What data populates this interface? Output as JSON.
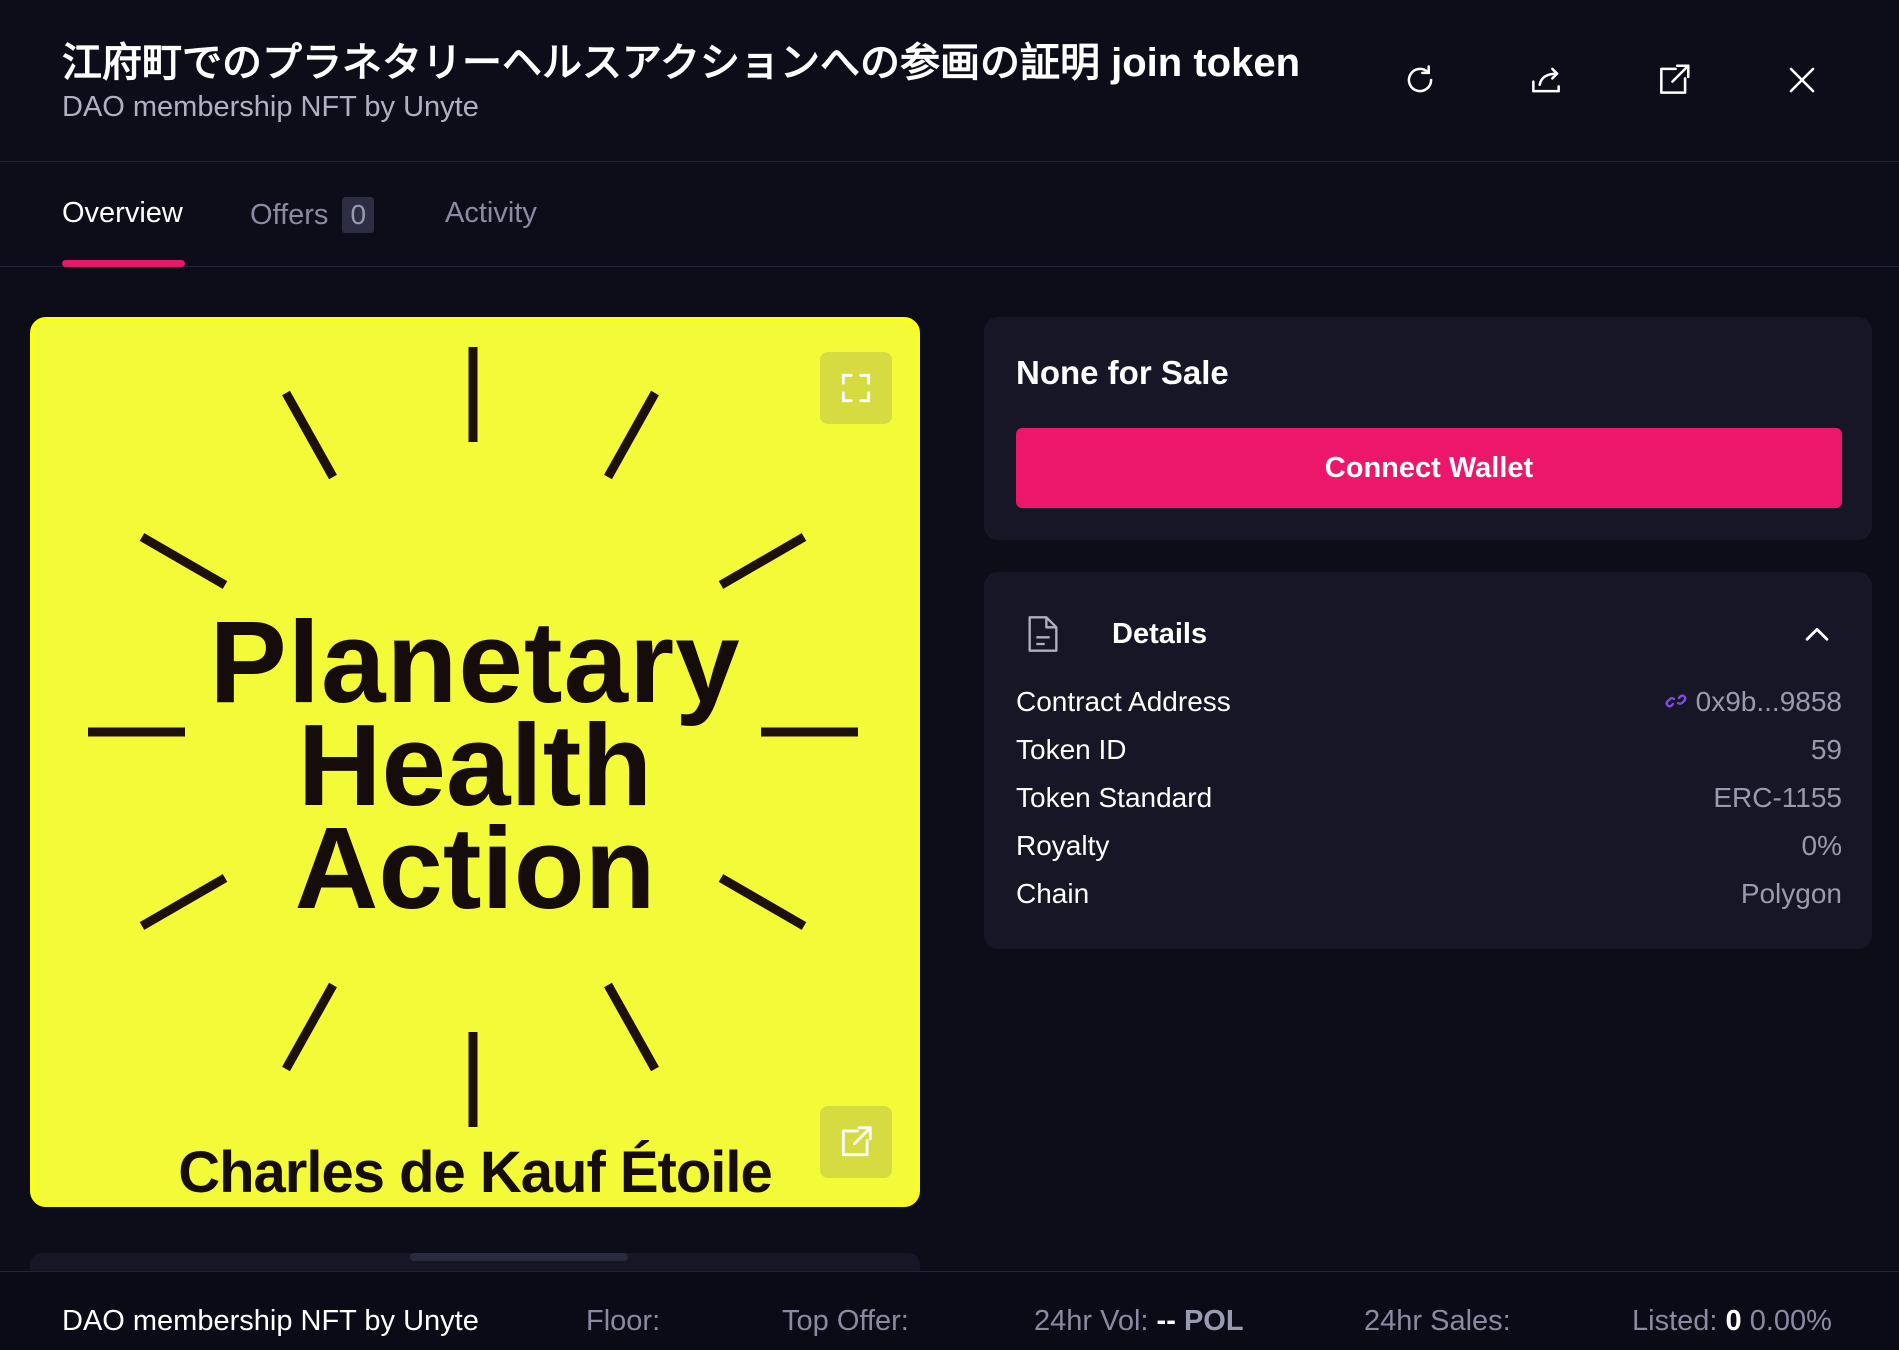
{
  "header": {
    "title": "江府町でのプラネタリーヘルスアクションへの参画の証明 join token",
    "subtitle": "DAO membership NFT by Unyte",
    "icons": [
      "refresh-icon",
      "share-icon",
      "external-link-icon",
      "close-icon"
    ]
  },
  "tabs": [
    {
      "label": "Overview",
      "active": true
    },
    {
      "label": "Offers",
      "count": "0"
    },
    {
      "label": "Activity"
    }
  ],
  "artwork": {
    "line1": "Planetary",
    "line2": "Health",
    "line3": "Action",
    "author": "Charles de Kauf Étoile",
    "background_color": "#f3fa37"
  },
  "sale": {
    "title": "None for Sale",
    "button_label": "Connect Wallet",
    "accent_color": "#ec166b"
  },
  "details": {
    "title": "Details",
    "rows": [
      {
        "label": "Contract Address",
        "value": "0x9b...9858"
      },
      {
        "label": "Token ID",
        "value": "59"
      },
      {
        "label": "Token Standard",
        "value": "ERC-1155"
      },
      {
        "label": "Royalty",
        "value": "0%"
      },
      {
        "label": "Chain",
        "value": "Polygon"
      }
    ]
  },
  "footer": {
    "collection": "DAO membership NFT by Unyte",
    "floor_label": "Floor:",
    "top_offer_label": "Top Offer:",
    "vol_label": "24hr Vol:",
    "vol_value": "--",
    "vol_unit": "POL",
    "sales_label": "24hr Sales:",
    "listed_label": "Listed:",
    "listed_count": "0",
    "listed_pct": "0.00%"
  }
}
